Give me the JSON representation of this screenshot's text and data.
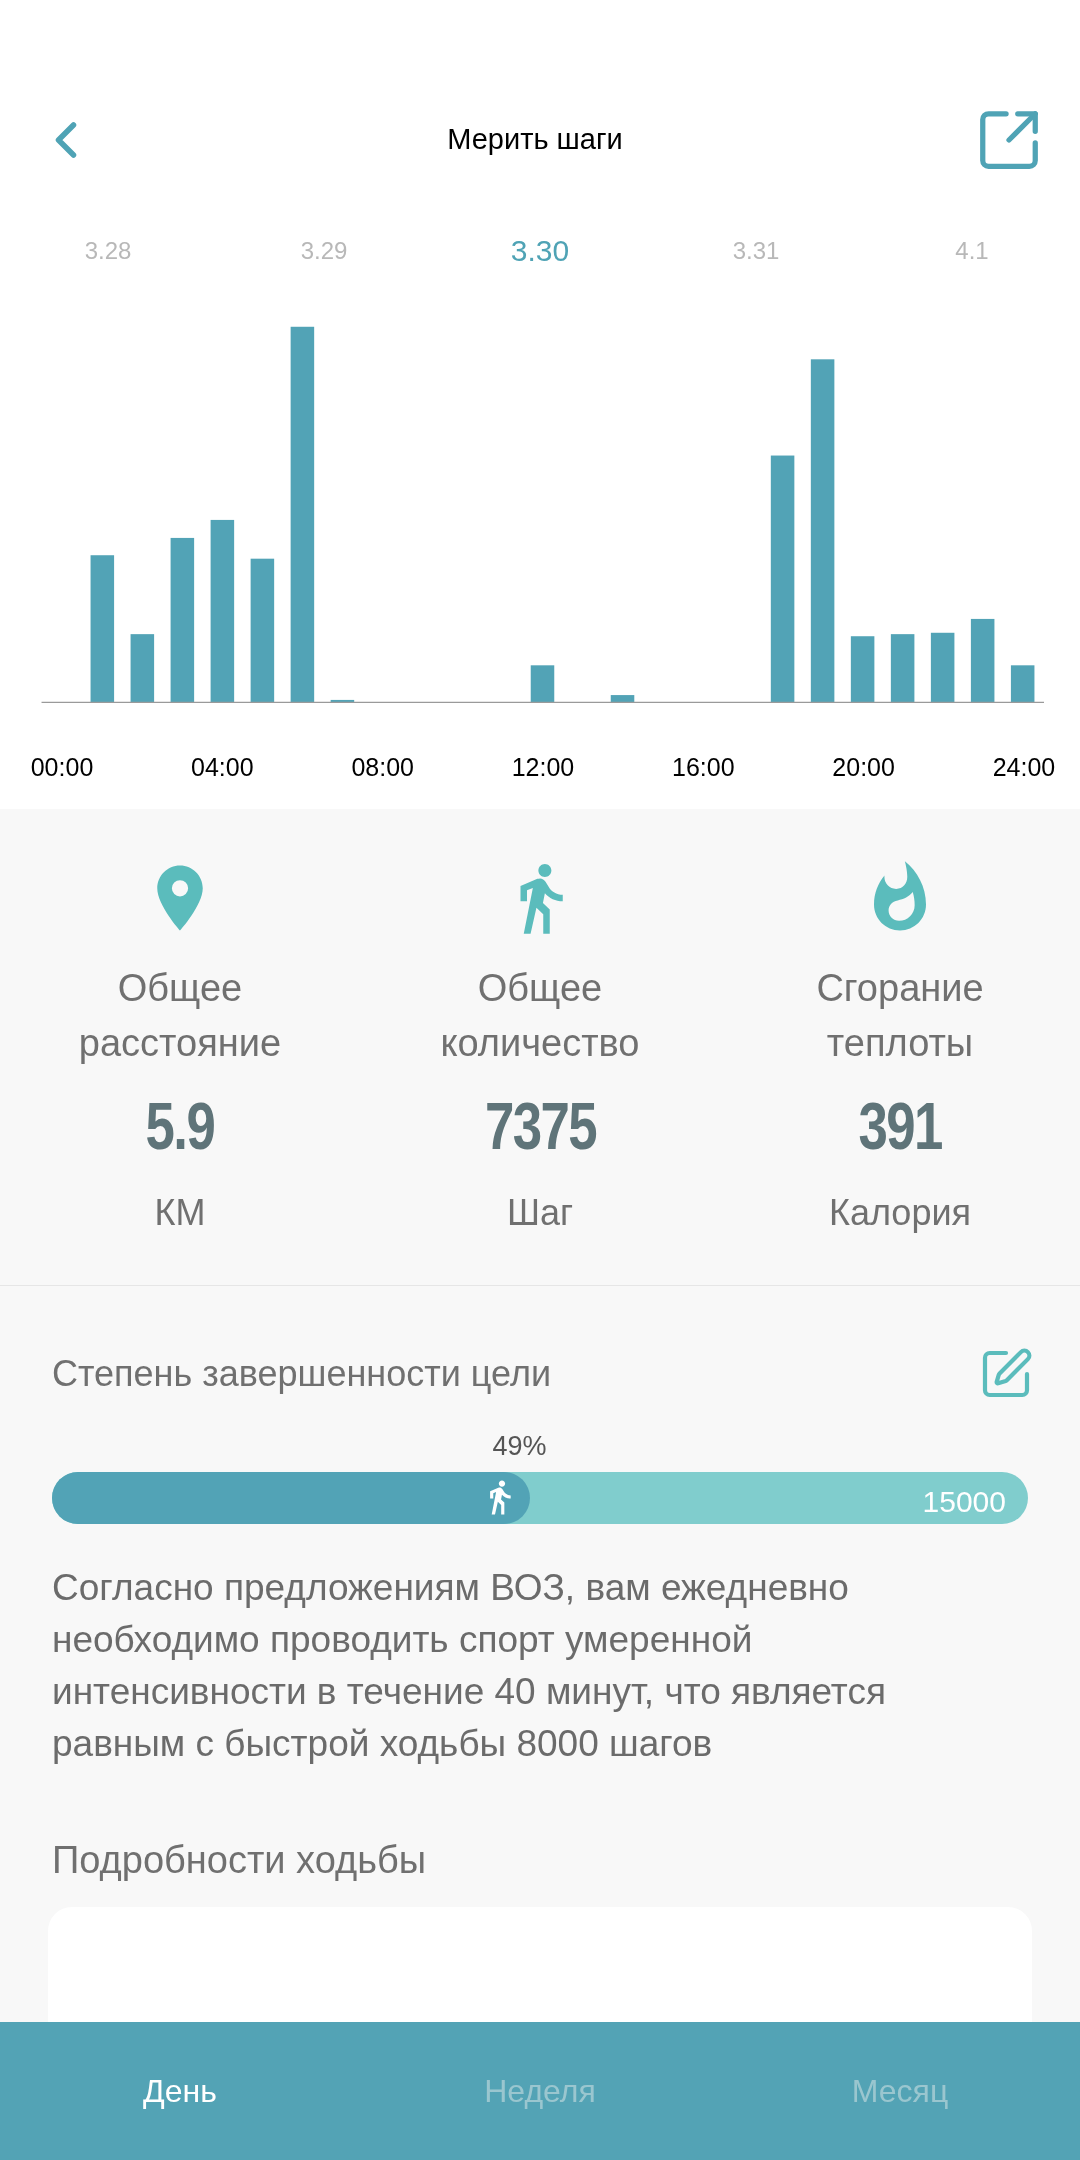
{
  "header": {
    "title": "Мерить шаги"
  },
  "dates": [
    {
      "label": "3.28",
      "selected": false
    },
    {
      "label": "3.29",
      "selected": false
    },
    {
      "label": "3.30",
      "selected": true
    },
    {
      "label": "3.31",
      "selected": false
    },
    {
      "label": "4.1",
      "selected": false
    }
  ],
  "chart": {
    "x_labels": [
      "00:00",
      "04:00",
      "08:00",
      "12:00",
      "16:00",
      "20:00",
      "24:00"
    ]
  },
  "stats": [
    {
      "kind": "distance",
      "label": "Общее расстояние",
      "value": "5.9",
      "unit": "КМ"
    },
    {
      "kind": "steps",
      "label": "Общее количество",
      "value": "7375",
      "unit": "Шаг"
    },
    {
      "kind": "calories",
      "label": "Сгорание теплоты",
      "value": "391",
      "unit": "Калория"
    }
  ],
  "goal": {
    "title": "Степень завершенности цели",
    "percent": "49%",
    "level": 0.49,
    "target": "15000",
    "note": "Согласно предложениям ВОЗ, вам ежедневно необходимо проводить спорт умеренной интенсивности в течение 40 минут, что является равным с быстрой ходьбы 8000 шагов"
  },
  "details": {
    "title": "Подробности ходьбы"
  },
  "tabs": [
    {
      "label": "День",
      "selected": true
    },
    {
      "label": "Неделя",
      "selected": false
    },
    {
      "label": "Месяц",
      "selected": false
    }
  ]
}
